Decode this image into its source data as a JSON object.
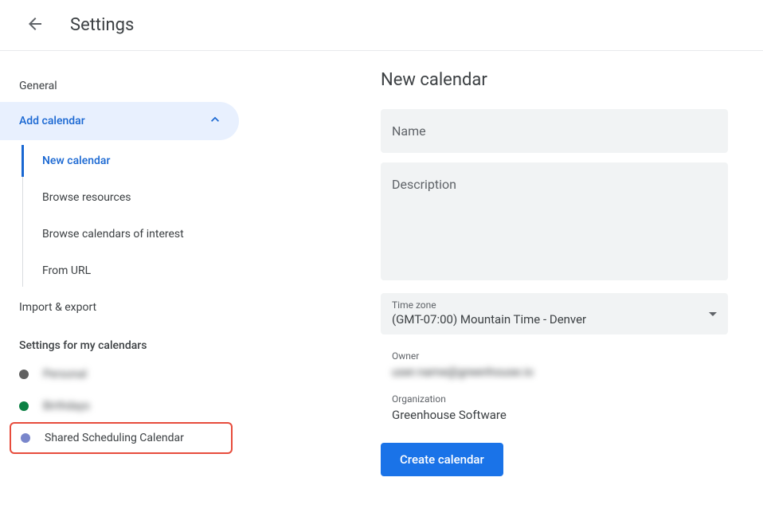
{
  "header": {
    "title": "Settings"
  },
  "sidebar": {
    "general": "General",
    "addCalendar": {
      "label": "Add calendar",
      "items": [
        "New calendar",
        "Browse resources",
        "Browse calendars of interest",
        "From URL"
      ]
    },
    "importExport": "Import & export",
    "settingsHeader": "Settings for my calendars",
    "calendars": [
      {
        "name": "Personal",
        "color": "#616161"
      },
      {
        "name": "Birthdays",
        "color": "#0b8043"
      },
      {
        "name": "Shared Scheduling Calendar",
        "color": "#7986cb"
      }
    ]
  },
  "main": {
    "title": "New calendar",
    "namePlaceholder": "Name",
    "descPlaceholder": "Description",
    "tzLabel": "Time zone",
    "tzValue": "(GMT-07:00) Mountain Time - Denver",
    "ownerLabel": "Owner",
    "ownerValue": "user.name@greenhouse.io",
    "orgLabel": "Organization",
    "orgValue": "Greenhouse Software",
    "createBtn": "Create calendar"
  }
}
